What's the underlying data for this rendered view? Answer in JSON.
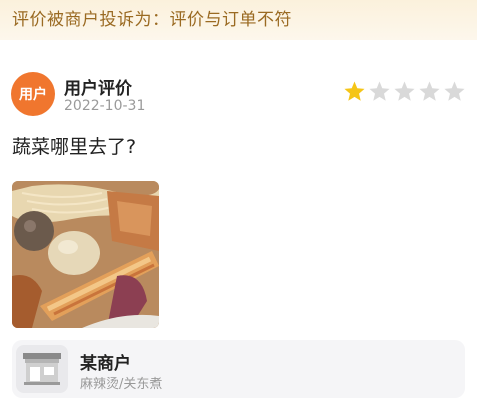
{
  "banner": {
    "text": "评价被商户投诉为：评价与订单不符"
  },
  "review": {
    "avatar_text": "用户",
    "user_name": "用户评价",
    "date": "2022-10-31",
    "rating": 1,
    "rating_max": 5,
    "content": "蔬菜哪里去了?",
    "colors": {
      "star_on": "#f5c518",
      "star_off": "#d9d9d9",
      "avatar_bg": "#f0762e"
    }
  },
  "photo": {
    "icon": "food-photo"
  },
  "merchant": {
    "name": "某商户",
    "category": "麻辣烫/关东煮",
    "icon": "storefront-icon"
  }
}
